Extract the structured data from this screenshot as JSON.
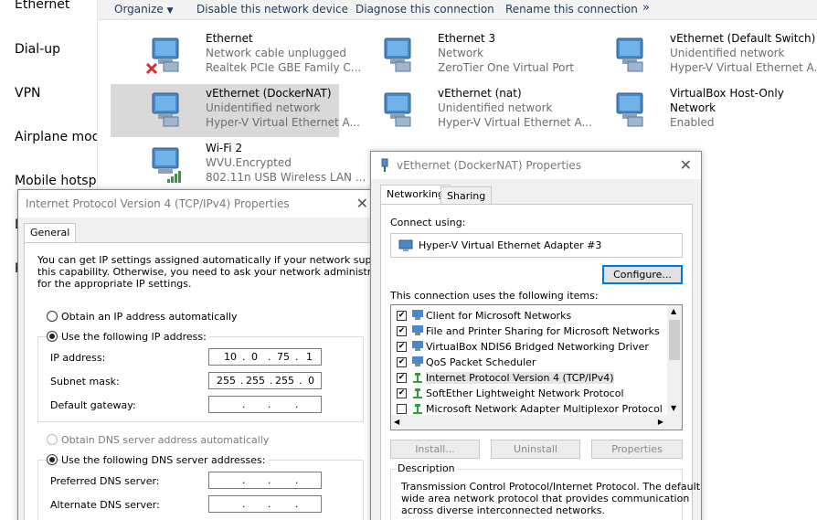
{
  "sidebar": {
    "items": [
      "Ethernet",
      "Dial-up",
      "VPN",
      "Airplane mod",
      "Mobile hotspo",
      "D",
      "P"
    ]
  },
  "toolbar": {
    "organize": "Organize",
    "disable": "Disable this network device",
    "diagnose": "Diagnose this connection",
    "rename": "Rename this connection",
    "more": "»"
  },
  "adapters": [
    {
      "name": "Ethernet",
      "status": "Network cable unplugged",
      "device": "Realtek PCIe GBE Family C..."
    },
    {
      "name": "Ethernet 3",
      "status": "Network",
      "device": "ZeroTier One Virtual Port"
    },
    {
      "name": "vEthernet (Default Switch)",
      "status": "Unidentified network",
      "device": "Hyper-V Virtual Ethernet A..."
    },
    {
      "name": "vEthernet (DockerNAT)",
      "status": "Unidentified network",
      "device": "Hyper-V Virtual Ethernet A..."
    },
    {
      "name": "vEthernet (nat)",
      "status": "Unidentified network",
      "device": "Hyper-V Virtual Ethernet A..."
    },
    {
      "name": "VirtualBox Host-Only",
      "status": "Network",
      "device": "Enabled"
    },
    {
      "name": "Wi-Fi 2",
      "status": "WVU.Encrypted",
      "device": "802.11n USB Wireless LAN ..."
    }
  ],
  "ipv4": {
    "title": "Internet Protocol Version 4 (TCP/IPv4) Properties",
    "close": "✕",
    "tab_general": "General",
    "intro1": "You can get IP settings assigned automatically if your network supports",
    "intro2": "this capability. Otherwise, you need to ask your network administrator",
    "intro3": "for the appropriate IP settings.",
    "auto_ip": "Obtain an IP address automatically",
    "manual_ip": "Use the following IP address:",
    "ip_label": "IP address:",
    "ip": [
      "10",
      "0",
      "75",
      "1"
    ],
    "mask_label": "Subnet mask:",
    "mask": [
      "255",
      "255",
      "255",
      "0"
    ],
    "gw_label": "Default gateway:",
    "auto_dns": "Obtain DNS server address automatically",
    "manual_dns": "Use the following DNS server addresses:",
    "pref_dns": "Preferred DNS server:",
    "alt_dns": "Alternate DNS server:",
    "dot": "."
  },
  "props": {
    "title": "vEthernet (DockerNAT) Properties",
    "close": "✕",
    "tab_networking": "Networking",
    "tab_sharing": "Sharing",
    "connect_using": "Connect using:",
    "adapter": "Hyper-V Virtual Ethernet Adapter #3",
    "configure": "Configure...",
    "items_label": "This connection uses the following items:",
    "items": [
      {
        "label": "Client for Microsoft Networks",
        "checked": true
      },
      {
        "label": "File and Printer Sharing for Microsoft Networks",
        "checked": true
      },
      {
        "label": "VirtualBox NDIS6 Bridged Networking Driver",
        "checked": true
      },
      {
        "label": "QoS Packet Scheduler",
        "checked": true
      },
      {
        "label": "Internet Protocol Version 4 (TCP/IPv4)",
        "checked": true
      },
      {
        "label": "SoftEther Lightweight Network Protocol",
        "checked": true
      },
      {
        "label": "Microsoft Network Adapter Multiplexor Protocol",
        "checked": false
      }
    ],
    "install": "Install...",
    "uninstall": "Uninstall",
    "properties": "Properties",
    "description_label": "Description",
    "desc1": "Transmission Control Protocol/Internet Protocol. The default",
    "desc2": "wide area network protocol that provides communication",
    "desc3": "across diverse interconnected networks."
  },
  "colors": {
    "accent": "#0078d7",
    "selection": "#d9d9d9",
    "check": "#000000"
  }
}
